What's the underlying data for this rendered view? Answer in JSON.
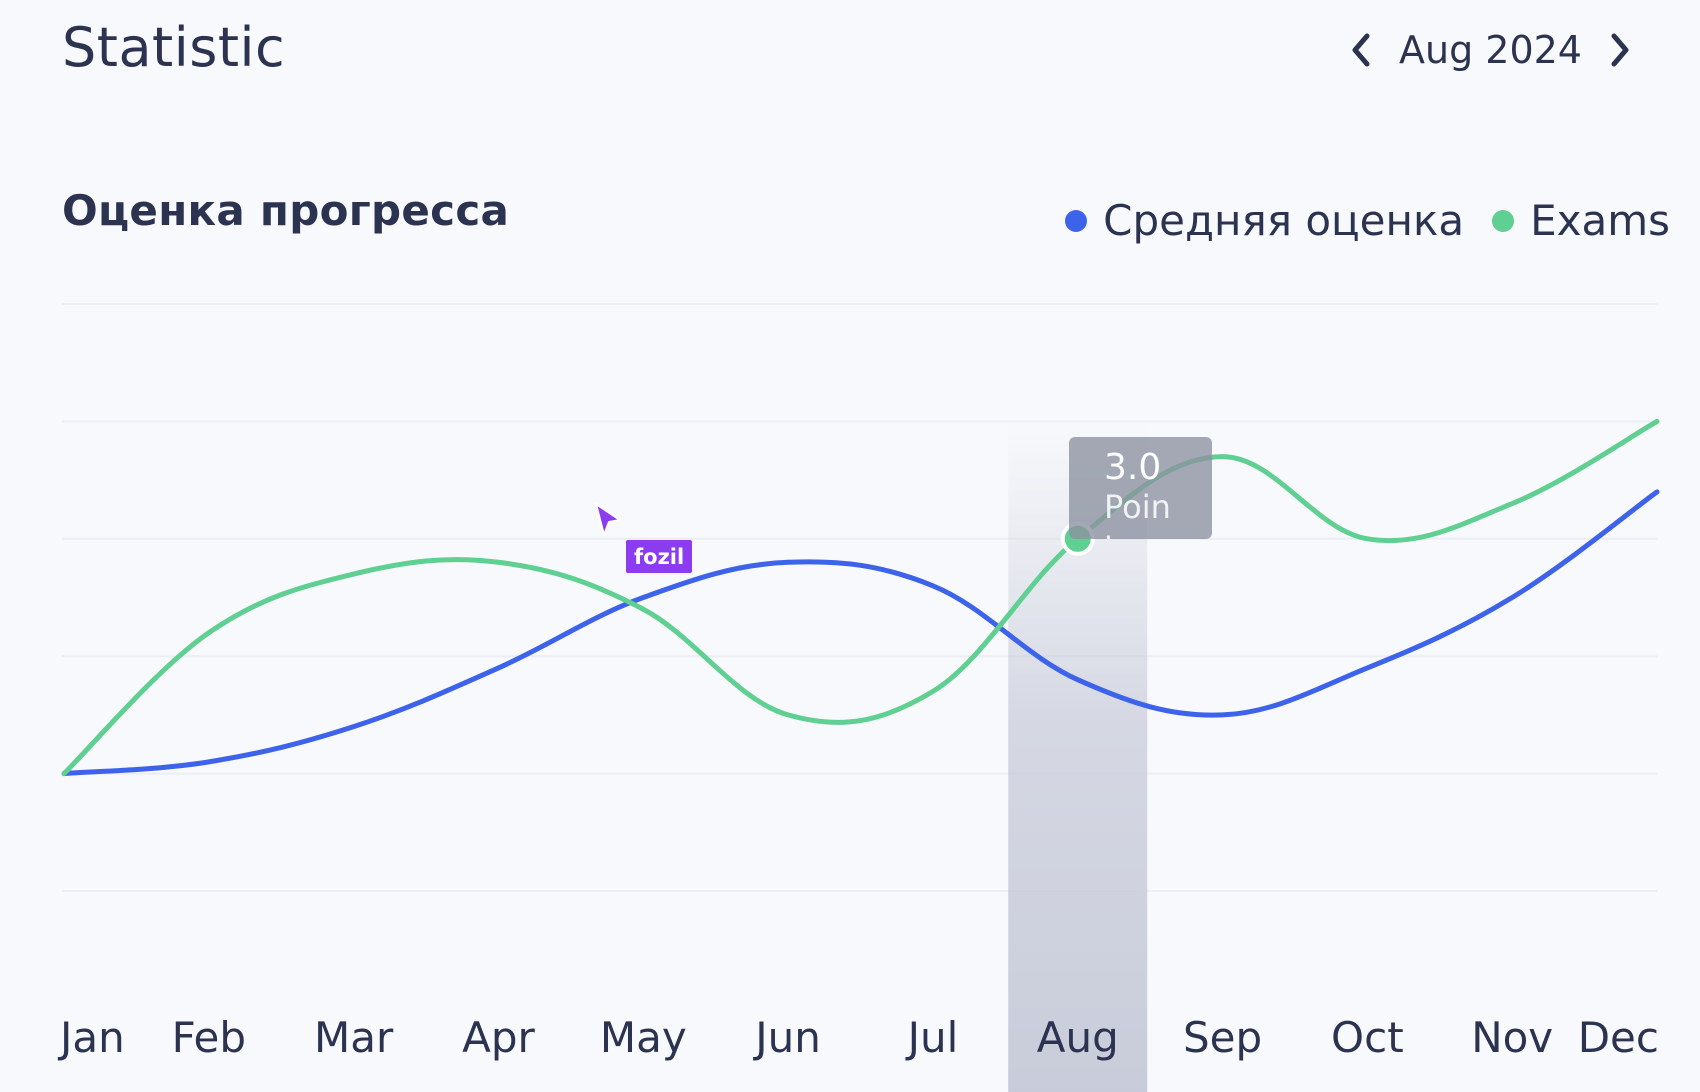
{
  "header": {
    "title": "Statistic",
    "period": "Aug 2024"
  },
  "icons": {
    "prev": "chevron-left-icon",
    "next": "chevron-right-icon",
    "cursor": "pointer-arrow-icon"
  },
  "tooltip": {
    "value": "3.0",
    "label": "Point"
  },
  "cursor_tag": "fozil",
  "colors": {
    "blue": "#3d63ea",
    "green": "#5fcf92",
    "highlight": "#c6cad8",
    "text": "#2b3350",
    "grid": "#eceef4",
    "cursor": "#8b3cf0"
  },
  "chart_data": {
    "type": "line",
    "title": "Оценка прогресса",
    "categories": [
      "Jan",
      "Feb",
      "Mar",
      "Apr",
      "May",
      "Jun",
      "Jul",
      "Aug",
      "Sep",
      "Oct",
      "Nov",
      "Dec"
    ],
    "series": [
      {
        "name": "Средняя оценка",
        "values": [
          1.0,
          1.1,
          1.4,
          1.9,
          2.5,
          2.8,
          2.6,
          1.8,
          1.5,
          1.9,
          2.5,
          3.4
        ]
      },
      {
        "name": "Exams",
        "values": [
          1.0,
          2.2,
          2.7,
          2.8,
          2.4,
          1.5,
          1.7,
          3.0,
          3.7,
          3.0,
          3.3,
          4.0
        ]
      }
    ],
    "highlight_category": "Aug",
    "ylim": [
      0,
      5
    ],
    "grid": true,
    "legend": "top-right"
  }
}
